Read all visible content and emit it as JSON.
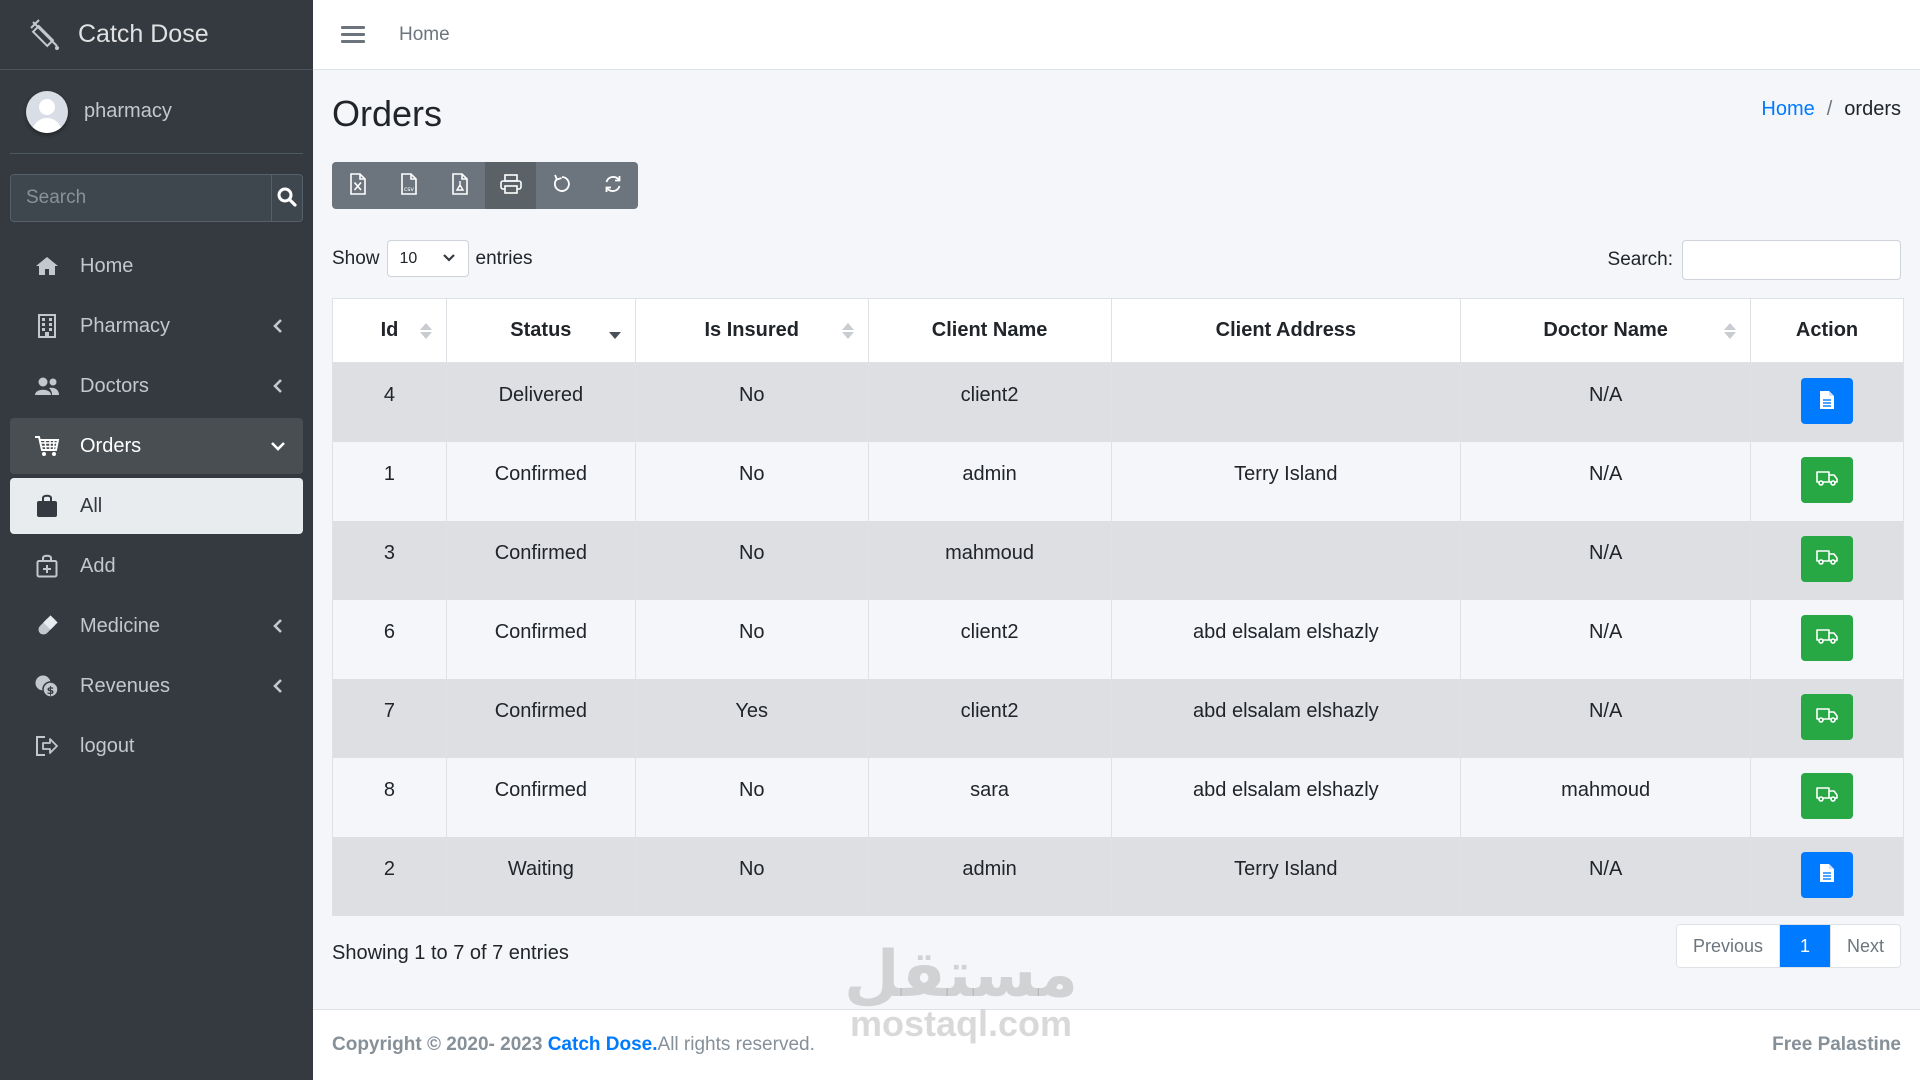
{
  "brand": {
    "name": "Catch Dose"
  },
  "user": {
    "name": "pharmacy"
  },
  "sidebar": {
    "search_placeholder": "Search",
    "items": [
      {
        "label": "Home",
        "icon": "home-icon"
      },
      {
        "label": "Pharmacy",
        "icon": "building-icon"
      },
      {
        "label": "Doctors",
        "icon": "users-icon"
      },
      {
        "label": "Orders",
        "icon": "cart-icon"
      },
      {
        "label": "All",
        "icon": "bag-icon"
      },
      {
        "label": "Add",
        "icon": "add-bag-icon"
      },
      {
        "label": "Medicine",
        "icon": "pill-icon"
      },
      {
        "label": "Revenues",
        "icon": "coins-icon"
      },
      {
        "label": "logout",
        "icon": "logout-icon"
      }
    ]
  },
  "topbar": {
    "home": "Home"
  },
  "page": {
    "title": "Orders",
    "breadcrumb": {
      "home": "Home",
      "sep": "/",
      "current": "orders"
    }
  },
  "controls": {
    "show_label": "Show",
    "entries_value": "10",
    "entries_label": "entries",
    "search_label": "Search:"
  },
  "table": {
    "columns": [
      "Id",
      "Status",
      "Is Insured",
      "Client Name",
      "Client Address",
      "Doctor Name",
      "Action"
    ],
    "rows": [
      {
        "id": "4",
        "status": "Delivered",
        "insured": "No",
        "client": "client2",
        "address": "",
        "doctor": "N/A",
        "action": "document"
      },
      {
        "id": "1",
        "status": "Confirmed",
        "insured": "No",
        "client": "admin",
        "address": "Terry Island",
        "doctor": "N/A",
        "action": "truck"
      },
      {
        "id": "3",
        "status": "Confirmed",
        "insured": "No",
        "client": "mahmoud",
        "address": "",
        "doctor": "N/A",
        "action": "truck"
      },
      {
        "id": "6",
        "status": "Confirmed",
        "insured": "No",
        "client": "client2",
        "address": "abd elsalam elshazly",
        "doctor": "N/A",
        "action": "truck"
      },
      {
        "id": "7",
        "status": "Confirmed",
        "insured": "Yes",
        "client": "client2",
        "address": "abd elsalam elshazly",
        "doctor": "N/A",
        "action": "truck"
      },
      {
        "id": "8",
        "status": "Confirmed",
        "insured": "No",
        "client": "sara",
        "address": "abd elsalam elshazly",
        "doctor": "mahmoud",
        "action": "truck"
      },
      {
        "id": "2",
        "status": "Waiting",
        "insured": "No",
        "client": "admin",
        "address": "Terry Island",
        "doctor": "N/A",
        "action": "document"
      }
    ]
  },
  "pagination": {
    "info": "Showing 1 to 7 of 7 entries",
    "previous": "Previous",
    "current": "1",
    "next": "Next"
  },
  "footer": {
    "copyright": "Copyright © 2020- 2023",
    "brand": "Catch Dose.",
    "rights": " All rights reserved.",
    "right": "Free Palastine"
  },
  "watermark": {
    "arabic": "مستقل",
    "latin": "mostaql.com"
  },
  "colors": {
    "sidebar": "#343a40",
    "primary": "#007bff",
    "success": "#28a745",
    "secondary": "#6c757d"
  }
}
